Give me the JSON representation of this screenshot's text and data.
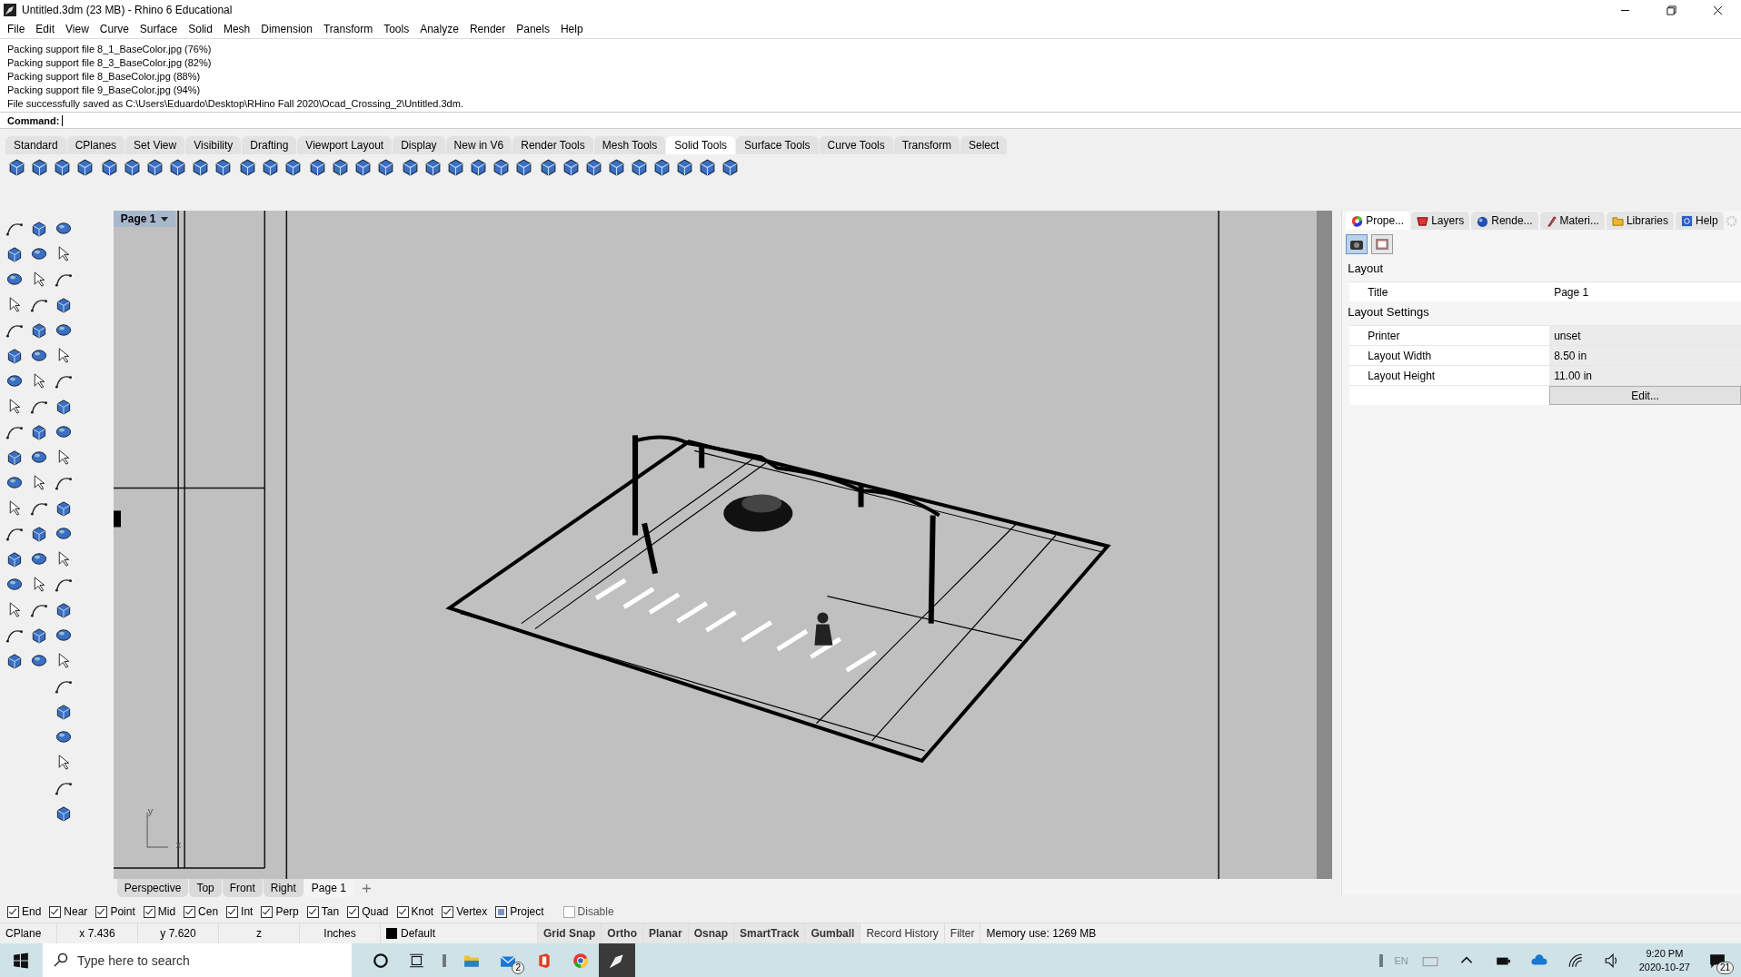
{
  "window": {
    "title": "Untitled.3dm (23 MB) - Rhino 6 Educational"
  },
  "menu": [
    "File",
    "Edit",
    "View",
    "Curve",
    "Surface",
    "Solid",
    "Mesh",
    "Dimension",
    "Transform",
    "Tools",
    "Analyze",
    "Render",
    "Panels",
    "Help"
  ],
  "history": [
    "Packing support file 8_1_BaseColor.jpg (76%)",
    "Packing support file 8_3_BaseColor.jpg (82%)",
    "Packing support file 8_BaseColor.jpg (88%)",
    "Packing support file 9_BaseColor.jpg (94%)",
    "File successfully saved as C:\\Users\\Eduardo\\Desktop\\RHino Fall 2020\\Ocad_Crossing_2\\Untitled.3dm."
  ],
  "command": {
    "label": "Command:"
  },
  "toolbar_tabs": [
    {
      "label": "Standard",
      "selected": false
    },
    {
      "label": "CPlanes",
      "selected": false
    },
    {
      "label": "Set View",
      "selected": false
    },
    {
      "label": "Visibility",
      "selected": false
    },
    {
      "label": "Drafting",
      "selected": false
    },
    {
      "label": "Viewport Layout",
      "selected": false
    },
    {
      "label": "Display",
      "selected": false
    },
    {
      "label": "New in V6",
      "selected": false
    },
    {
      "label": "Render Tools",
      "selected": false
    },
    {
      "label": "Mesh Tools",
      "selected": false
    },
    {
      "label": "Solid Tools",
      "selected": true
    },
    {
      "label": "Surface Tools",
      "selected": false
    },
    {
      "label": "Curve Tools",
      "selected": false
    },
    {
      "label": "Transform",
      "selected": false
    },
    {
      "label": "Select",
      "selected": false
    }
  ],
  "viewport": {
    "title": "Page 1",
    "axis_y": "y",
    "axis_x": "x"
  },
  "viewport_tabs": [
    {
      "label": "Perspective",
      "selected": false
    },
    {
      "label": "Top",
      "selected": false
    },
    {
      "label": "Front",
      "selected": false
    },
    {
      "label": "Right",
      "selected": false
    },
    {
      "label": "Page 1",
      "selected": true
    }
  ],
  "panel": {
    "tabs": [
      {
        "label": "Prope...",
        "kind": "wheel",
        "selected": true
      },
      {
        "label": "Layers",
        "kind": "layers",
        "selected": false
      },
      {
        "label": "Rende...",
        "kind": "sphere",
        "selected": false
      },
      {
        "label": "Materi...",
        "kind": "brush",
        "selected": false
      },
      {
        "label": "Libraries",
        "kind": "folder",
        "selected": false
      },
      {
        "label": "Help",
        "kind": "help",
        "selected": false
      }
    ],
    "view_buttons": [
      {
        "kind": "camera",
        "selected": true
      },
      {
        "kind": "frame",
        "selected": false
      }
    ],
    "sections": [
      {
        "title": "Layout",
        "rows": [
          {
            "label": "Title",
            "value": "Page 1",
            "editable": true
          }
        ]
      },
      {
        "title": "Layout Settings",
        "rows": [
          {
            "label": "Printer",
            "value": "unset",
            "editable": false
          },
          {
            "label": "Layout Width",
            "value": "8.50 in",
            "editable": false
          },
          {
            "label": "Layout Height",
            "value": "11.00 in",
            "editable": false
          }
        ],
        "button": "Edit..."
      }
    ]
  },
  "osnaps": [
    {
      "label": "End",
      "checked": true
    },
    {
      "label": "Near",
      "checked": true
    },
    {
      "label": "Point",
      "checked": true
    },
    {
      "label": "Mid",
      "checked": true
    },
    {
      "label": "Cen",
      "checked": true
    },
    {
      "label": "Int",
      "checked": true
    },
    {
      "label": "Perp",
      "checked": true
    },
    {
      "label": "Tan",
      "checked": true
    },
    {
      "label": "Quad",
      "checked": true
    },
    {
      "label": "Knot",
      "checked": true
    },
    {
      "label": "Vertex",
      "checked": true
    }
  ],
  "project": {
    "label": "Project",
    "checked": true
  },
  "disable": {
    "label": "Disable",
    "checked": false
  },
  "status": {
    "cplane": "CPlane",
    "x": "x 7.436",
    "y": "y 7.620",
    "z": "z",
    "units": "Inches",
    "layer": {
      "name": "Default",
      "color": "#000000"
    },
    "toggles": [
      {
        "label": "Grid Snap",
        "on": true
      },
      {
        "label": "Ortho",
        "on": true
      },
      {
        "label": "Planar",
        "on": true
      },
      {
        "label": "Osnap",
        "on": true
      },
      {
        "label": "SmartTrack",
        "on": true
      },
      {
        "label": "Gumball",
        "on": true
      },
      {
        "label": "Record History",
        "on": false
      },
      {
        "label": "Filter",
        "on": false
      }
    ],
    "memory": "Memory use: 1269 MB"
  },
  "taskbar": {
    "search": {
      "placeholder": "Type here to search"
    },
    "mail_badge": "2",
    "language": "EN",
    "time": "9:20 PM",
    "date": "2020-10-27",
    "notifications": "21"
  }
}
